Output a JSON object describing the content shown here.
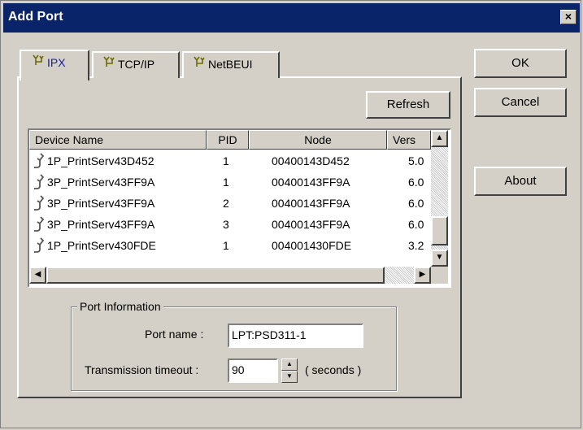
{
  "window": {
    "title": "Add Port",
    "close_glyph": "×"
  },
  "tabs": [
    {
      "label": "IPX",
      "icon": "network-plug-icon",
      "active": true
    },
    {
      "label": "TCP/IP",
      "icon": "network-plug-icon",
      "active": false
    },
    {
      "label": "NetBEUI",
      "icon": "network-plug-icon",
      "active": false
    }
  ],
  "buttons": {
    "ok": "OK",
    "cancel": "Cancel",
    "about": "About",
    "refresh": "Refresh"
  },
  "list": {
    "columns": [
      "Device Name",
      "PID",
      "Node",
      "Vers"
    ],
    "rows": [
      {
        "name": "1P_PrintServ43D452",
        "pid": "1",
        "node": "00400143D452",
        "version": "5.0"
      },
      {
        "name": "3P_PrintServ43FF9A",
        "pid": "1",
        "node": "00400143FF9A",
        "version": "6.0"
      },
      {
        "name": "3P_PrintServ43FF9A",
        "pid": "2",
        "node": "00400143FF9A",
        "version": "6.0"
      },
      {
        "name": "3P_PrintServ43FF9A",
        "pid": "3",
        "node": "00400143FF9A",
        "version": "6.0"
      },
      {
        "name": "1P_PrintServ430FDE",
        "pid": "1",
        "node": "004001430FDE",
        "version": "3.2"
      }
    ]
  },
  "port_info": {
    "legend": "Port Information",
    "port_name_label": "Port name :",
    "port_name_value": "LPT:PSD311-1",
    "timeout_label": "Transmission timeout :",
    "timeout_value": "90",
    "timeout_unit": "( seconds )"
  }
}
